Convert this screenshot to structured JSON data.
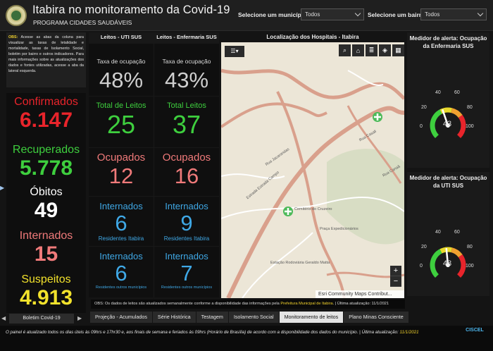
{
  "header": {
    "title": "Itabira no monitoramento da Covid-19",
    "subtitle": "PROGRAMA CIDADES SAUDÁVEIS",
    "municipio_label": "Selecione um município:",
    "municipio_value": "Todos",
    "bairro_label": "Selecione um bairro:",
    "bairro_value": "Todos"
  },
  "obs_note": {
    "prefix": "OBS:",
    "text": "Acesse as abas da coluna para visualizar as taxas de letalidade e mortalidade, taxas de Isolamento Social, boletim por bairro e outros indicadores. Para mais informações sobre as atualizações dos dados e fontes utilizadas, acesse a aba da lateral esquerda."
  },
  "left_stats": [
    {
      "label": "Confirmados",
      "value": "6.147",
      "color": "#e8242b"
    },
    {
      "label": "Recuperados",
      "value": "5.778",
      "color": "#3ecf3e"
    },
    {
      "label": "Óbitos",
      "value": "49",
      "color": "#ffffff"
    },
    {
      "label": "Internados",
      "value": "15",
      "color": "#f07a7a"
    },
    {
      "label": "Suspeitos",
      "value": "4.913",
      "color": "#f2e22c"
    }
  ],
  "left_tab": "Boletim Covid-19",
  "beds": {
    "uti_header": "Leitos - UTI SUS",
    "enf_header": "Leitos - Enfermaria SUS",
    "uti": {
      "ocupacao_label": "Taxa de ocupação",
      "ocupacao_value": "48%",
      "total_label": "Total de Leitos",
      "total_value": "25",
      "ocupados_label": "Ocupados",
      "ocupados_value": "12",
      "internados_label": "Internados",
      "internados_value": "6",
      "residentes_label": "Residentes Itabira",
      "internados2_label": "Internados",
      "internados2_value": "6",
      "outros_label": "Residentes outros municípios"
    },
    "enf": {
      "ocupacao_label": "Taxa de ocupação",
      "ocupacao_value": "43%",
      "total_label": "Total Leitos",
      "total_value": "37",
      "ocupados_label": "Ocupados",
      "ocupados_value": "16",
      "internados_label": "Internados",
      "internados_value": "9",
      "residentes_label": "Residentes Itabira",
      "internados2_label": "Internados",
      "internados2_value": "7",
      "outros_label": "Residentes outros municípios"
    }
  },
  "map": {
    "title": "Localização dos Hospitais - Itabira",
    "attribution": "Esri Community Maps Contribut...",
    "zoom_in": "+",
    "zoom_out": "−",
    "labels": {
      "estrada": "Estrada Estrada Campo",
      "cemiterio": "Cemitério do Cruzeiro",
      "praca": "Praça Expedicionários",
      "estacao": "Estação Rodoviária Geraldo Matta",
      "rua1": "Rua Casali",
      "rua2": "Rua Jacarandas",
      "rua3": "Rua Canaã"
    }
  },
  "gauges": [
    {
      "title": "Medidor de alerta: Ocupação da Enfermaria SUS",
      "value": 43,
      "ticks": [
        "0",
        "20",
        "40",
        "60",
        "80",
        "100"
      ]
    },
    {
      "title": "Medidor de alerta: Ocupação da UTI SUS",
      "value": 48,
      "ticks": [
        "0",
        "20",
        "40",
        "60",
        "80",
        "100"
      ]
    }
  ],
  "obs_bar": {
    "text": "OBS: Os dados de leitos são atualizados semanalmente conforme a disponibilidade das informações pela",
    "highlight": "Prefeitura Municipal de Itabira",
    "suffix": ". | Última atualização: 11/1/2021"
  },
  "tabs": [
    "Projeção - Acumulados",
    "Série Histórica",
    "Testagem",
    "Isolamento Social",
    "Monitoramento de leitos",
    "Plano Minas Consciente"
  ],
  "footer": {
    "text": "O painel é atualizado todos os dias úteis às 09hrs e 17hr30 e, aos finais de semana e feriados às 09hrs (Horário de Brasília) de acordo com a disponibilidade dos dados do município. | Última atualização:",
    "date": "11/1/2021",
    "brand": "CISCEL"
  }
}
